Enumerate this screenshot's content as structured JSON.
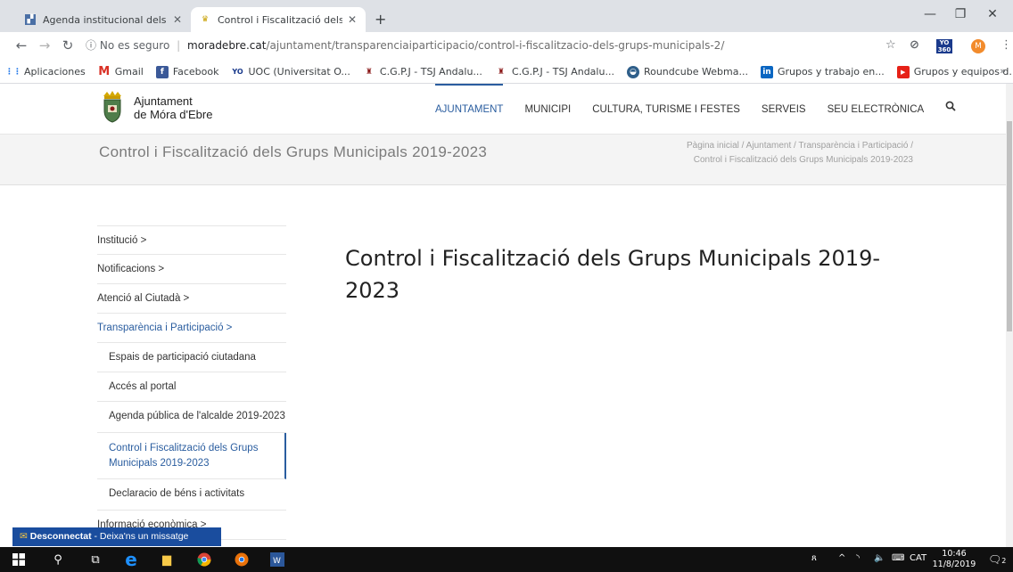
{
  "browser": {
    "tabs": [
      {
        "title": "Agenda institucional dels alts càr"
      },
      {
        "title": "Control i Fiscalització dels Grups"
      }
    ],
    "address": {
      "security_label": "No es seguro",
      "domain": "moradebre.cat",
      "path": "/ajuntament/transparenciaiparticipacio/control-i-fiscalitzacio-dels-grups-municipals-2/"
    },
    "avatar_letter": "M",
    "yo_badge": "YO 360",
    "bookmarks": [
      {
        "label": "Aplicaciones",
        "icon": "apps-grid-icon"
      },
      {
        "label": "Gmail",
        "icon": "gmail-icon"
      },
      {
        "label": "Facebook",
        "icon": "facebook-icon"
      },
      {
        "label": "UOC (Universitat O...",
        "icon": "uoc-icon"
      },
      {
        "label": "C.G.P.J - TSJ Andalu...",
        "icon": "cgpj-icon"
      },
      {
        "label": "C.G.P.J - TSJ Andalu...",
        "icon": "cgpj-icon"
      },
      {
        "label": "Roundcube Webma...",
        "icon": "roundcube-icon"
      },
      {
        "label": "Grupos y trabajo en...",
        "icon": "linkedin-icon"
      },
      {
        "label": "Grupos y equipos d...",
        "icon": "youtube-icon"
      }
    ],
    "bookmarks_more": "»"
  },
  "site": {
    "name_line1": "Ajuntament",
    "name_line2": "de Móra d'Ebre",
    "nav": [
      {
        "label": "AJUNTAMENT",
        "active": true
      },
      {
        "label": "MUNICIPI"
      },
      {
        "label": "CULTURA, TURISME I FESTES"
      },
      {
        "label": "SERVEIS"
      },
      {
        "label": "SEU ELECTRÒNICA"
      }
    ],
    "band_title": "Control i Fiscalització dels Grups Municipals 2019-2023",
    "breadcrumb_line1": "Pàgina inicial / Ajuntament / Transparència i Participació /",
    "breadcrumb_line2": "Control i Fiscalització dels Grups Municipals 2019-2023",
    "sidebar": [
      {
        "label": "Institució  >"
      },
      {
        "label": "Notificacions  >"
      },
      {
        "label": "Atenció al Ciutadà  >"
      },
      {
        "label": "Transparència i Participació  >"
      },
      {
        "label": "Espais de participació ciutadana"
      },
      {
        "label": "Accés al portal"
      },
      {
        "label": "Agenda pública de l'alcalde 2019-2023"
      },
      {
        "label": "Control i Fiscalització dels Grups Municipals 2019-2023"
      },
      {
        "label": "Declaracio de béns i activitats"
      },
      {
        "label": "Informació econòmica  >"
      }
    ],
    "content_title": "Control i Fiscalització dels Grups Municipals 2019-2023",
    "accent_color": "#2a5d9f"
  },
  "chat": {
    "status": "Desconnectat",
    "message": " - Deixa'ns un missatge"
  },
  "taskbar": {
    "language": "CAT",
    "time": "10:46",
    "date": "11/8/2019",
    "notifications": "2"
  }
}
